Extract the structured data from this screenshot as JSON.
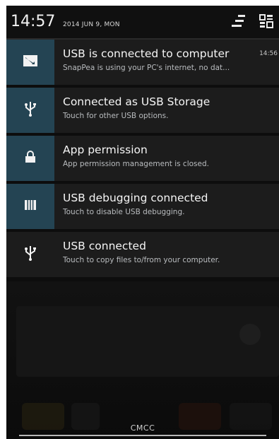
{
  "status_bar": {
    "time": "14:57",
    "date": "2014 JUN 9, MON",
    "icons": [
      "quick-settings-toggle-icon",
      "grid-settings-icon"
    ]
  },
  "notifications": [
    {
      "icon": "display-icon",
      "title": "USB is connected to computer",
      "subtitle": "SnapPea is using your PC's internet, no dat...",
      "time": "14:56",
      "highlighted": true
    },
    {
      "icon": "usb-icon",
      "title": "Connected as USB Storage",
      "subtitle": "Touch for other USB options.",
      "highlighted": true
    },
    {
      "icon": "lock-icon",
      "title": "App permission",
      "subtitle": "App permission management is closed.",
      "highlighted": true
    },
    {
      "icon": "usb-debugging-icon",
      "title": "USB debugging connected",
      "subtitle": "Touch to disable USB debugging.",
      "highlighted": true
    },
    {
      "icon": "usb-icon",
      "title": "USB connected",
      "subtitle": "Touch to copy files to/from your computer.",
      "highlighted": false
    }
  ],
  "footer": {
    "carrier": "CMCC"
  },
  "colors": {
    "background": "#0d0d0d",
    "notification": "#1c1c1c",
    "icon_tile": "#244453",
    "subtitle": "#b9bcbf"
  }
}
